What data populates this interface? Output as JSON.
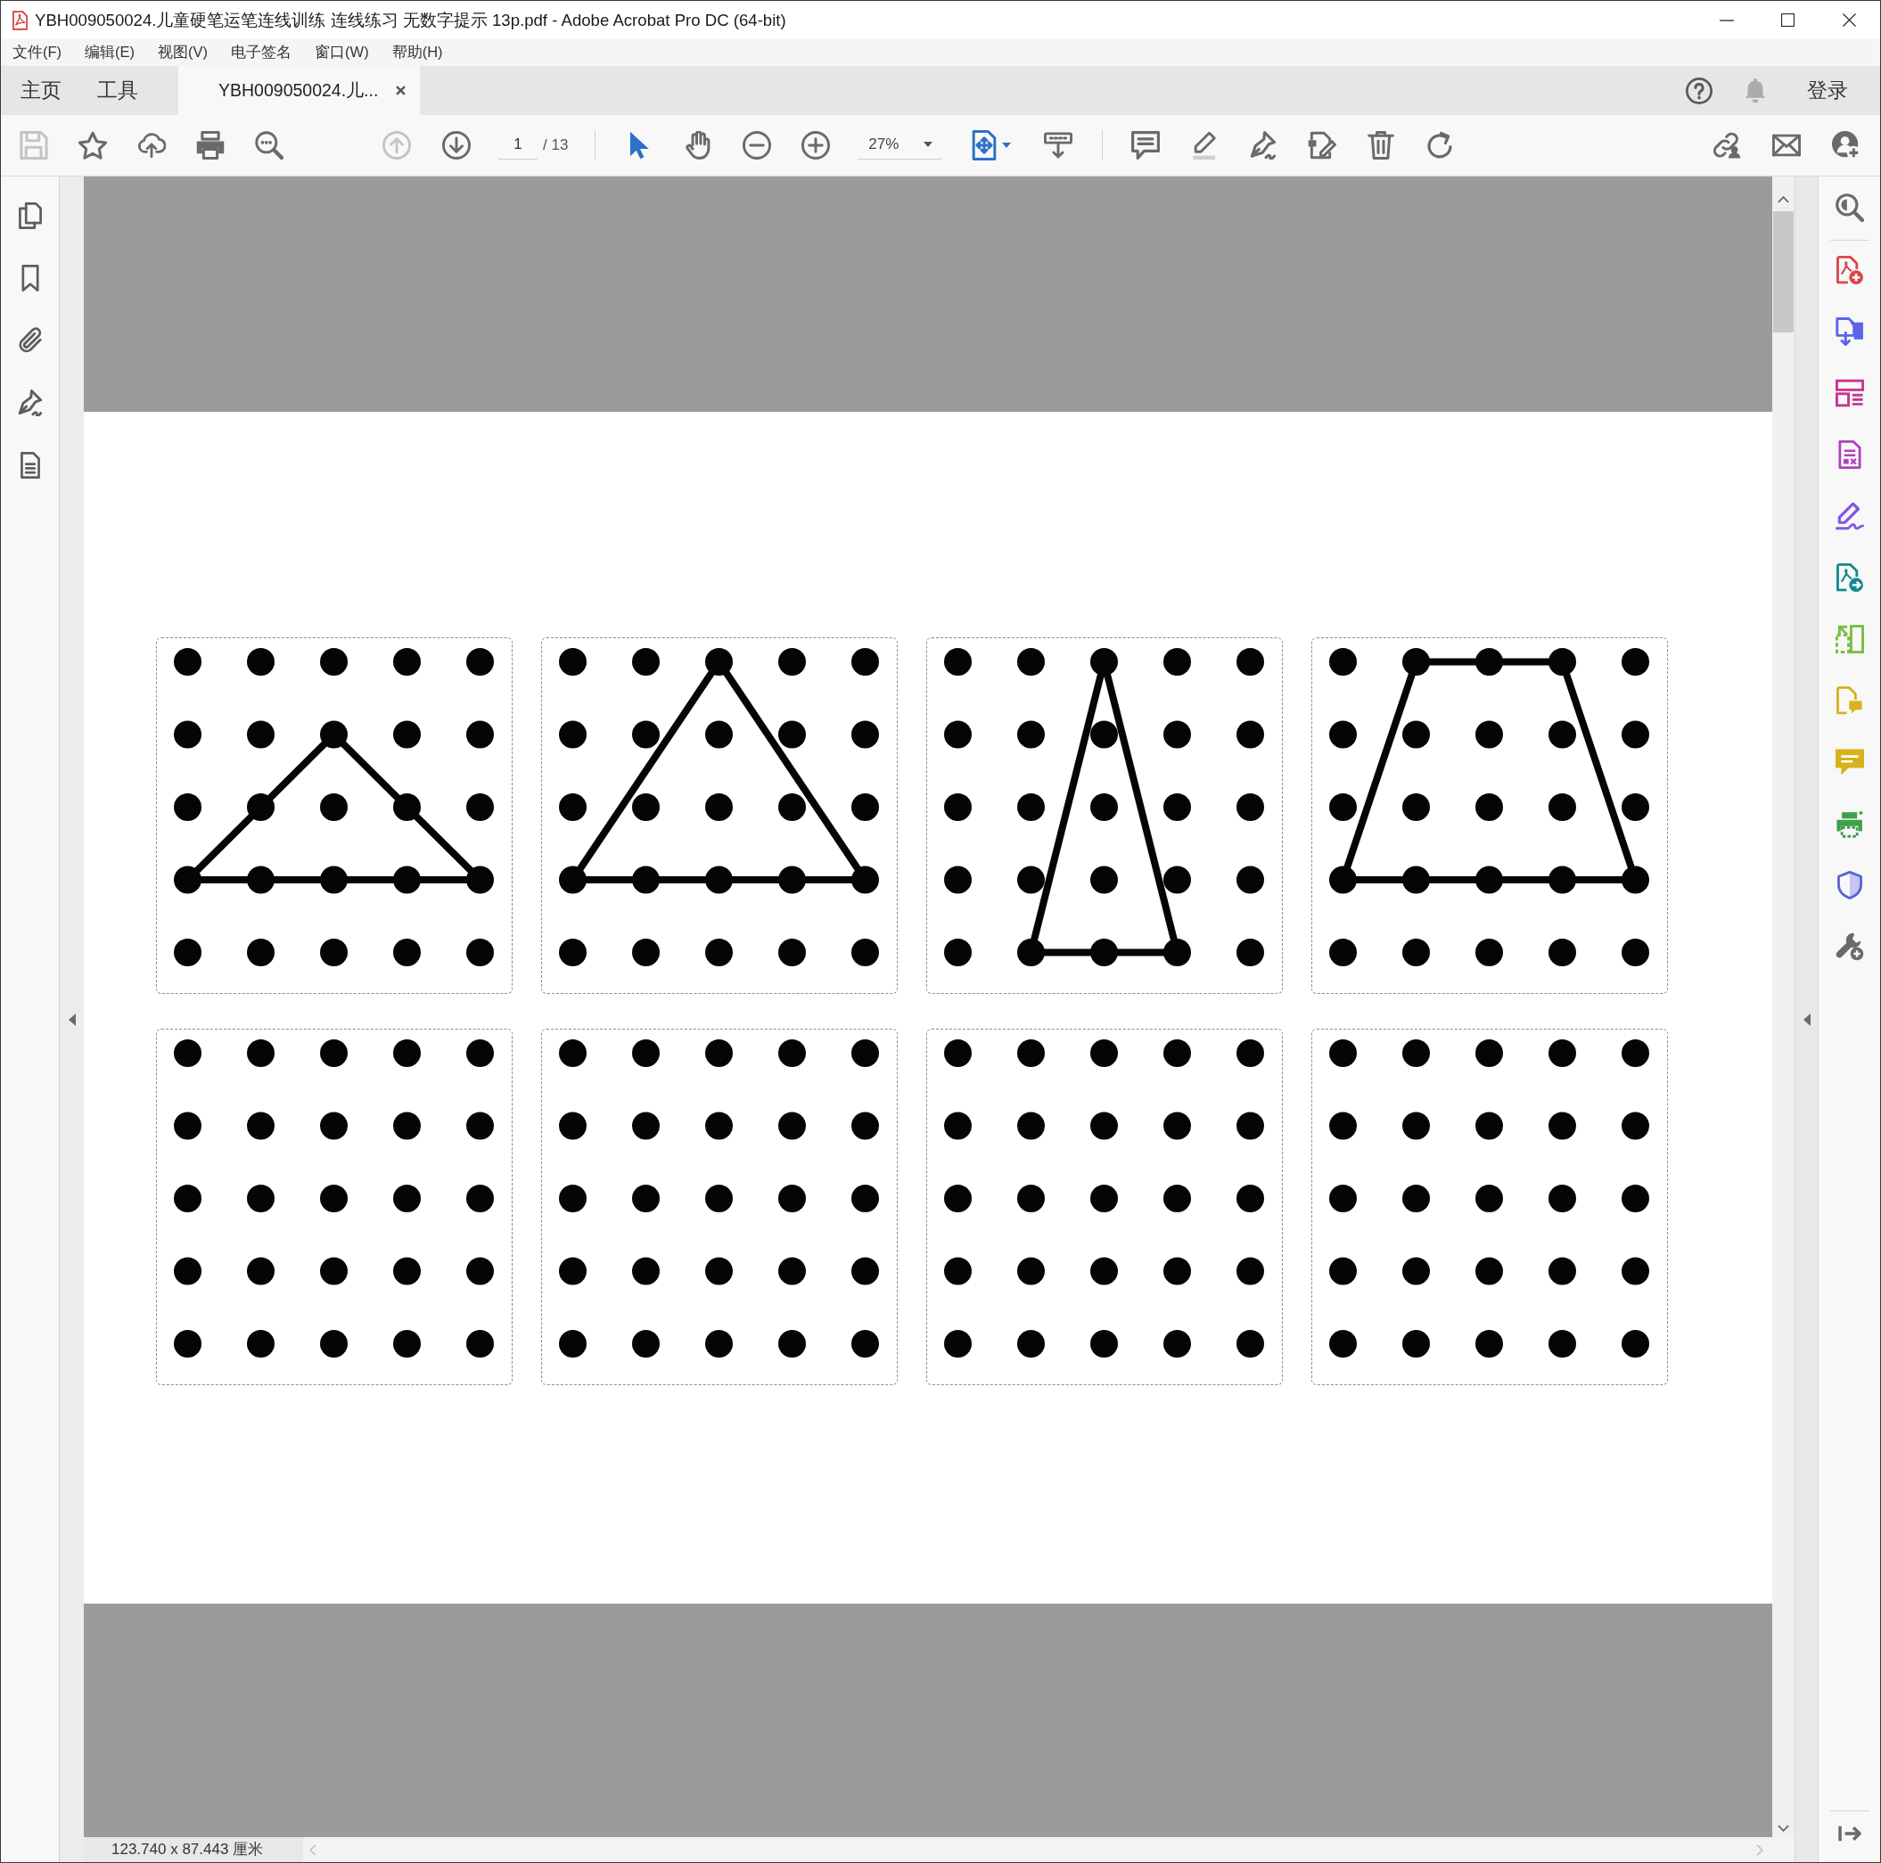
{
  "window": {
    "title": "YBH009050024.儿童硬笔运笔连线训练 连线练习 无数字提示 13p.pdf - Adobe Acrobat Pro DC (64-bit)"
  },
  "menu": [
    "文件(F)",
    "编辑(E)",
    "视图(V)",
    "电子签名",
    "窗口(W)",
    "帮助(H)"
  ],
  "tabs": [
    {
      "kind": "view",
      "label": "主页",
      "selected": false
    },
    {
      "kind": "view",
      "label": "工具",
      "selected": false
    },
    {
      "kind": "document",
      "label": "YBH009050024.儿...",
      "selected": true
    }
  ],
  "account": {
    "sign_in": "登录"
  },
  "toolbar": {
    "file_tools": [
      {
        "kind": "save",
        "disabled": true
      },
      {
        "kind": "star",
        "disabled": false
      },
      {
        "kind": "upload",
        "disabled": false
      },
      {
        "kind": "print",
        "disabled": false
      },
      {
        "kind": "search",
        "disabled": false
      }
    ],
    "page_buttons": [
      {
        "kind": "previous",
        "disabled": true
      },
      {
        "kind": "next",
        "disabled": false
      }
    ],
    "page": "1",
    "page_count": "/ 13",
    "pointer_tools": [
      {
        "kind": "select",
        "selected": true
      },
      {
        "kind": "hand",
        "selected": false
      }
    ],
    "zoom": "27%"
  },
  "document": {
    "cards": [
      {
        "kind": "low-triangle"
      },
      {
        "kind": "triangle"
      },
      {
        "kind": "tall-triangle"
      },
      {
        "kind": "trapezoid"
      },
      {
        "kind": "blank"
      },
      {
        "kind": "blank"
      },
      {
        "kind": "blank"
      },
      {
        "kind": "blank"
      }
    ]
  },
  "status_bar": {
    "page_size": "123.740 x 87.443 厘米"
  }
}
